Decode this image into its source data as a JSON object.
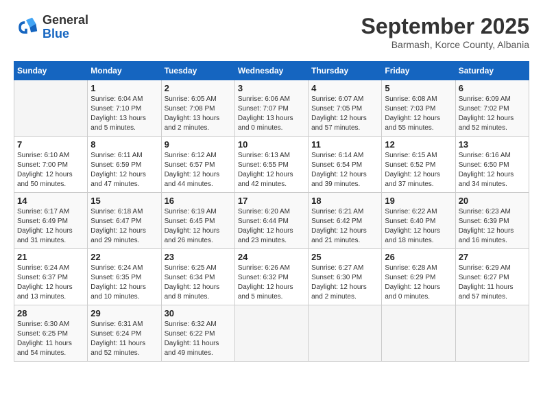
{
  "header": {
    "logo_general": "General",
    "logo_blue": "Blue",
    "month": "September 2025",
    "location": "Barmash, Korce County, Albania"
  },
  "days_of_week": [
    "Sunday",
    "Monday",
    "Tuesday",
    "Wednesday",
    "Thursday",
    "Friday",
    "Saturday"
  ],
  "weeks": [
    [
      {
        "num": "",
        "info": ""
      },
      {
        "num": "1",
        "info": "Sunrise: 6:04 AM\nSunset: 7:10 PM\nDaylight: 13 hours\nand 5 minutes."
      },
      {
        "num": "2",
        "info": "Sunrise: 6:05 AM\nSunset: 7:08 PM\nDaylight: 13 hours\nand 2 minutes."
      },
      {
        "num": "3",
        "info": "Sunrise: 6:06 AM\nSunset: 7:07 PM\nDaylight: 13 hours\nand 0 minutes."
      },
      {
        "num": "4",
        "info": "Sunrise: 6:07 AM\nSunset: 7:05 PM\nDaylight: 12 hours\nand 57 minutes."
      },
      {
        "num": "5",
        "info": "Sunrise: 6:08 AM\nSunset: 7:03 PM\nDaylight: 12 hours\nand 55 minutes."
      },
      {
        "num": "6",
        "info": "Sunrise: 6:09 AM\nSunset: 7:02 PM\nDaylight: 12 hours\nand 52 minutes."
      }
    ],
    [
      {
        "num": "7",
        "info": "Sunrise: 6:10 AM\nSunset: 7:00 PM\nDaylight: 12 hours\nand 50 minutes."
      },
      {
        "num": "8",
        "info": "Sunrise: 6:11 AM\nSunset: 6:59 PM\nDaylight: 12 hours\nand 47 minutes."
      },
      {
        "num": "9",
        "info": "Sunrise: 6:12 AM\nSunset: 6:57 PM\nDaylight: 12 hours\nand 44 minutes."
      },
      {
        "num": "10",
        "info": "Sunrise: 6:13 AM\nSunset: 6:55 PM\nDaylight: 12 hours\nand 42 minutes."
      },
      {
        "num": "11",
        "info": "Sunrise: 6:14 AM\nSunset: 6:54 PM\nDaylight: 12 hours\nand 39 minutes."
      },
      {
        "num": "12",
        "info": "Sunrise: 6:15 AM\nSunset: 6:52 PM\nDaylight: 12 hours\nand 37 minutes."
      },
      {
        "num": "13",
        "info": "Sunrise: 6:16 AM\nSunset: 6:50 PM\nDaylight: 12 hours\nand 34 minutes."
      }
    ],
    [
      {
        "num": "14",
        "info": "Sunrise: 6:17 AM\nSunset: 6:49 PM\nDaylight: 12 hours\nand 31 minutes."
      },
      {
        "num": "15",
        "info": "Sunrise: 6:18 AM\nSunset: 6:47 PM\nDaylight: 12 hours\nand 29 minutes."
      },
      {
        "num": "16",
        "info": "Sunrise: 6:19 AM\nSunset: 6:45 PM\nDaylight: 12 hours\nand 26 minutes."
      },
      {
        "num": "17",
        "info": "Sunrise: 6:20 AM\nSunset: 6:44 PM\nDaylight: 12 hours\nand 23 minutes."
      },
      {
        "num": "18",
        "info": "Sunrise: 6:21 AM\nSunset: 6:42 PM\nDaylight: 12 hours\nand 21 minutes."
      },
      {
        "num": "19",
        "info": "Sunrise: 6:22 AM\nSunset: 6:40 PM\nDaylight: 12 hours\nand 18 minutes."
      },
      {
        "num": "20",
        "info": "Sunrise: 6:23 AM\nSunset: 6:39 PM\nDaylight: 12 hours\nand 16 minutes."
      }
    ],
    [
      {
        "num": "21",
        "info": "Sunrise: 6:24 AM\nSunset: 6:37 PM\nDaylight: 12 hours\nand 13 minutes."
      },
      {
        "num": "22",
        "info": "Sunrise: 6:24 AM\nSunset: 6:35 PM\nDaylight: 12 hours\nand 10 minutes."
      },
      {
        "num": "23",
        "info": "Sunrise: 6:25 AM\nSunset: 6:34 PM\nDaylight: 12 hours\nand 8 minutes."
      },
      {
        "num": "24",
        "info": "Sunrise: 6:26 AM\nSunset: 6:32 PM\nDaylight: 12 hours\nand 5 minutes."
      },
      {
        "num": "25",
        "info": "Sunrise: 6:27 AM\nSunset: 6:30 PM\nDaylight: 12 hours\nand 2 minutes."
      },
      {
        "num": "26",
        "info": "Sunrise: 6:28 AM\nSunset: 6:29 PM\nDaylight: 12 hours\nand 0 minutes."
      },
      {
        "num": "27",
        "info": "Sunrise: 6:29 AM\nSunset: 6:27 PM\nDaylight: 11 hours\nand 57 minutes."
      }
    ],
    [
      {
        "num": "28",
        "info": "Sunrise: 6:30 AM\nSunset: 6:25 PM\nDaylight: 11 hours\nand 54 minutes."
      },
      {
        "num": "29",
        "info": "Sunrise: 6:31 AM\nSunset: 6:24 PM\nDaylight: 11 hours\nand 52 minutes."
      },
      {
        "num": "30",
        "info": "Sunrise: 6:32 AM\nSunset: 6:22 PM\nDaylight: 11 hours\nand 49 minutes."
      },
      {
        "num": "",
        "info": ""
      },
      {
        "num": "",
        "info": ""
      },
      {
        "num": "",
        "info": ""
      },
      {
        "num": "",
        "info": ""
      }
    ]
  ]
}
